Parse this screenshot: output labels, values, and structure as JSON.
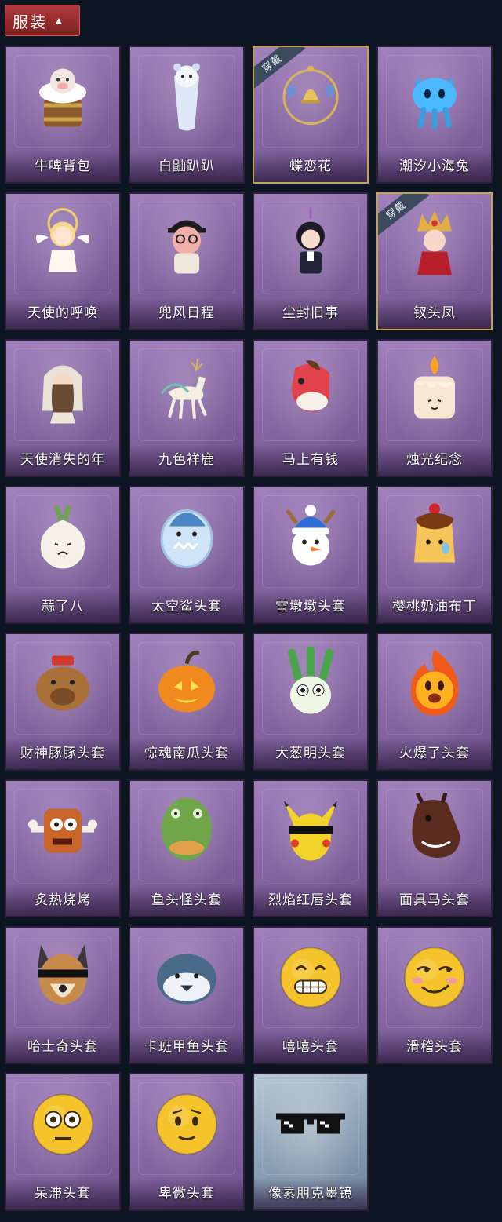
{
  "header": {
    "label": "服装",
    "chevron": "▲"
  },
  "items": [
    {
      "name": "牛啤背包",
      "icon": "cow-beer-backpack-icon",
      "equipped": false
    },
    {
      "name": "白鼬趴趴",
      "icon": "white-ferret-icon",
      "equipped": false
    },
    {
      "name": "蝶恋花",
      "icon": "butterfly-bell-charm-icon",
      "equipped": true,
      "badge": "穿戴"
    },
    {
      "name": "潮汐小海兔",
      "icon": "blue-sea-bunny-icon",
      "equipped": false
    },
    {
      "name": "天使的呼唤",
      "icon": "angel-doll-icon",
      "equipped": false
    },
    {
      "name": "兜风日程",
      "icon": "cap-pig-doll-icon",
      "equipped": false
    },
    {
      "name": "尘封旧事",
      "icon": "gentleman-doll-icon",
      "equipped": false
    },
    {
      "name": "钗头凤",
      "icon": "phoenix-crown-doll-icon",
      "equipped": true,
      "badge": "穿戴"
    },
    {
      "name": "天使消失的年",
      "icon": "veiled-angel-doll-icon",
      "equipped": false
    },
    {
      "name": "九色祥鹿",
      "icon": "nine-color-deer-icon",
      "equipped": false
    },
    {
      "name": "马上有钱",
      "icon": "red-horse-head-icon",
      "equipped": false
    },
    {
      "name": "烛光纪念",
      "icon": "candle-head-icon",
      "equipped": false
    },
    {
      "name": "蒜了八",
      "icon": "garlic-head-icon",
      "equipped": false
    },
    {
      "name": "太空鲨头套",
      "icon": "space-shark-head-icon",
      "equipped": false
    },
    {
      "name": "雪墩墩头套",
      "icon": "snowman-reindeer-head-icon",
      "equipped": false
    },
    {
      "name": "樱桃奶油布丁",
      "icon": "cherry-pudding-head-icon",
      "equipped": false
    },
    {
      "name": "财神豚豚头套",
      "icon": "fortune-capybara-head-icon",
      "equipped": false
    },
    {
      "name": "惊魂南瓜头套",
      "icon": "pumpkin-head-icon",
      "equipped": false
    },
    {
      "name": "大葱明头套",
      "icon": "scallion-head-icon",
      "equipped": false
    },
    {
      "name": "火爆了头套",
      "icon": "fire-head-icon",
      "equipped": false
    },
    {
      "name": "炙热烧烤",
      "icon": "bbq-meat-head-icon",
      "equipped": false
    },
    {
      "name": "鱼头怪头套",
      "icon": "fish-monster-head-icon",
      "equipped": false
    },
    {
      "name": "烈焰红唇头套",
      "icon": "yellow-mouse-head-icon",
      "equipped": false
    },
    {
      "name": "面具马头套",
      "icon": "horse-mask-icon",
      "equipped": false
    },
    {
      "name": "哈士奇头套",
      "icon": "husky-head-icon",
      "equipped": false
    },
    {
      "name": "卡班甲鱼头套",
      "icon": "turtle-head-icon",
      "equipped": false
    },
    {
      "name": "嘻嘻头套",
      "icon": "grin-emoji-head-icon",
      "equipped": false
    },
    {
      "name": "滑稽头套",
      "icon": "funny-emoji-head-icon",
      "equipped": false
    },
    {
      "name": "呆滞头套",
      "icon": "dazed-emoji-head-icon",
      "equipped": false
    },
    {
      "name": "卑微头套",
      "icon": "humble-emoji-head-icon",
      "equipped": false
    },
    {
      "name": "像素朋克墨镜",
      "icon": "pixel-sunglasses-icon",
      "equipped": false,
      "special": true
    }
  ],
  "colors": {
    "background": "#0e1522",
    "card": "#8a6aa6",
    "header": "#9c2e2e",
    "equipped_border": "#c4a354"
  }
}
